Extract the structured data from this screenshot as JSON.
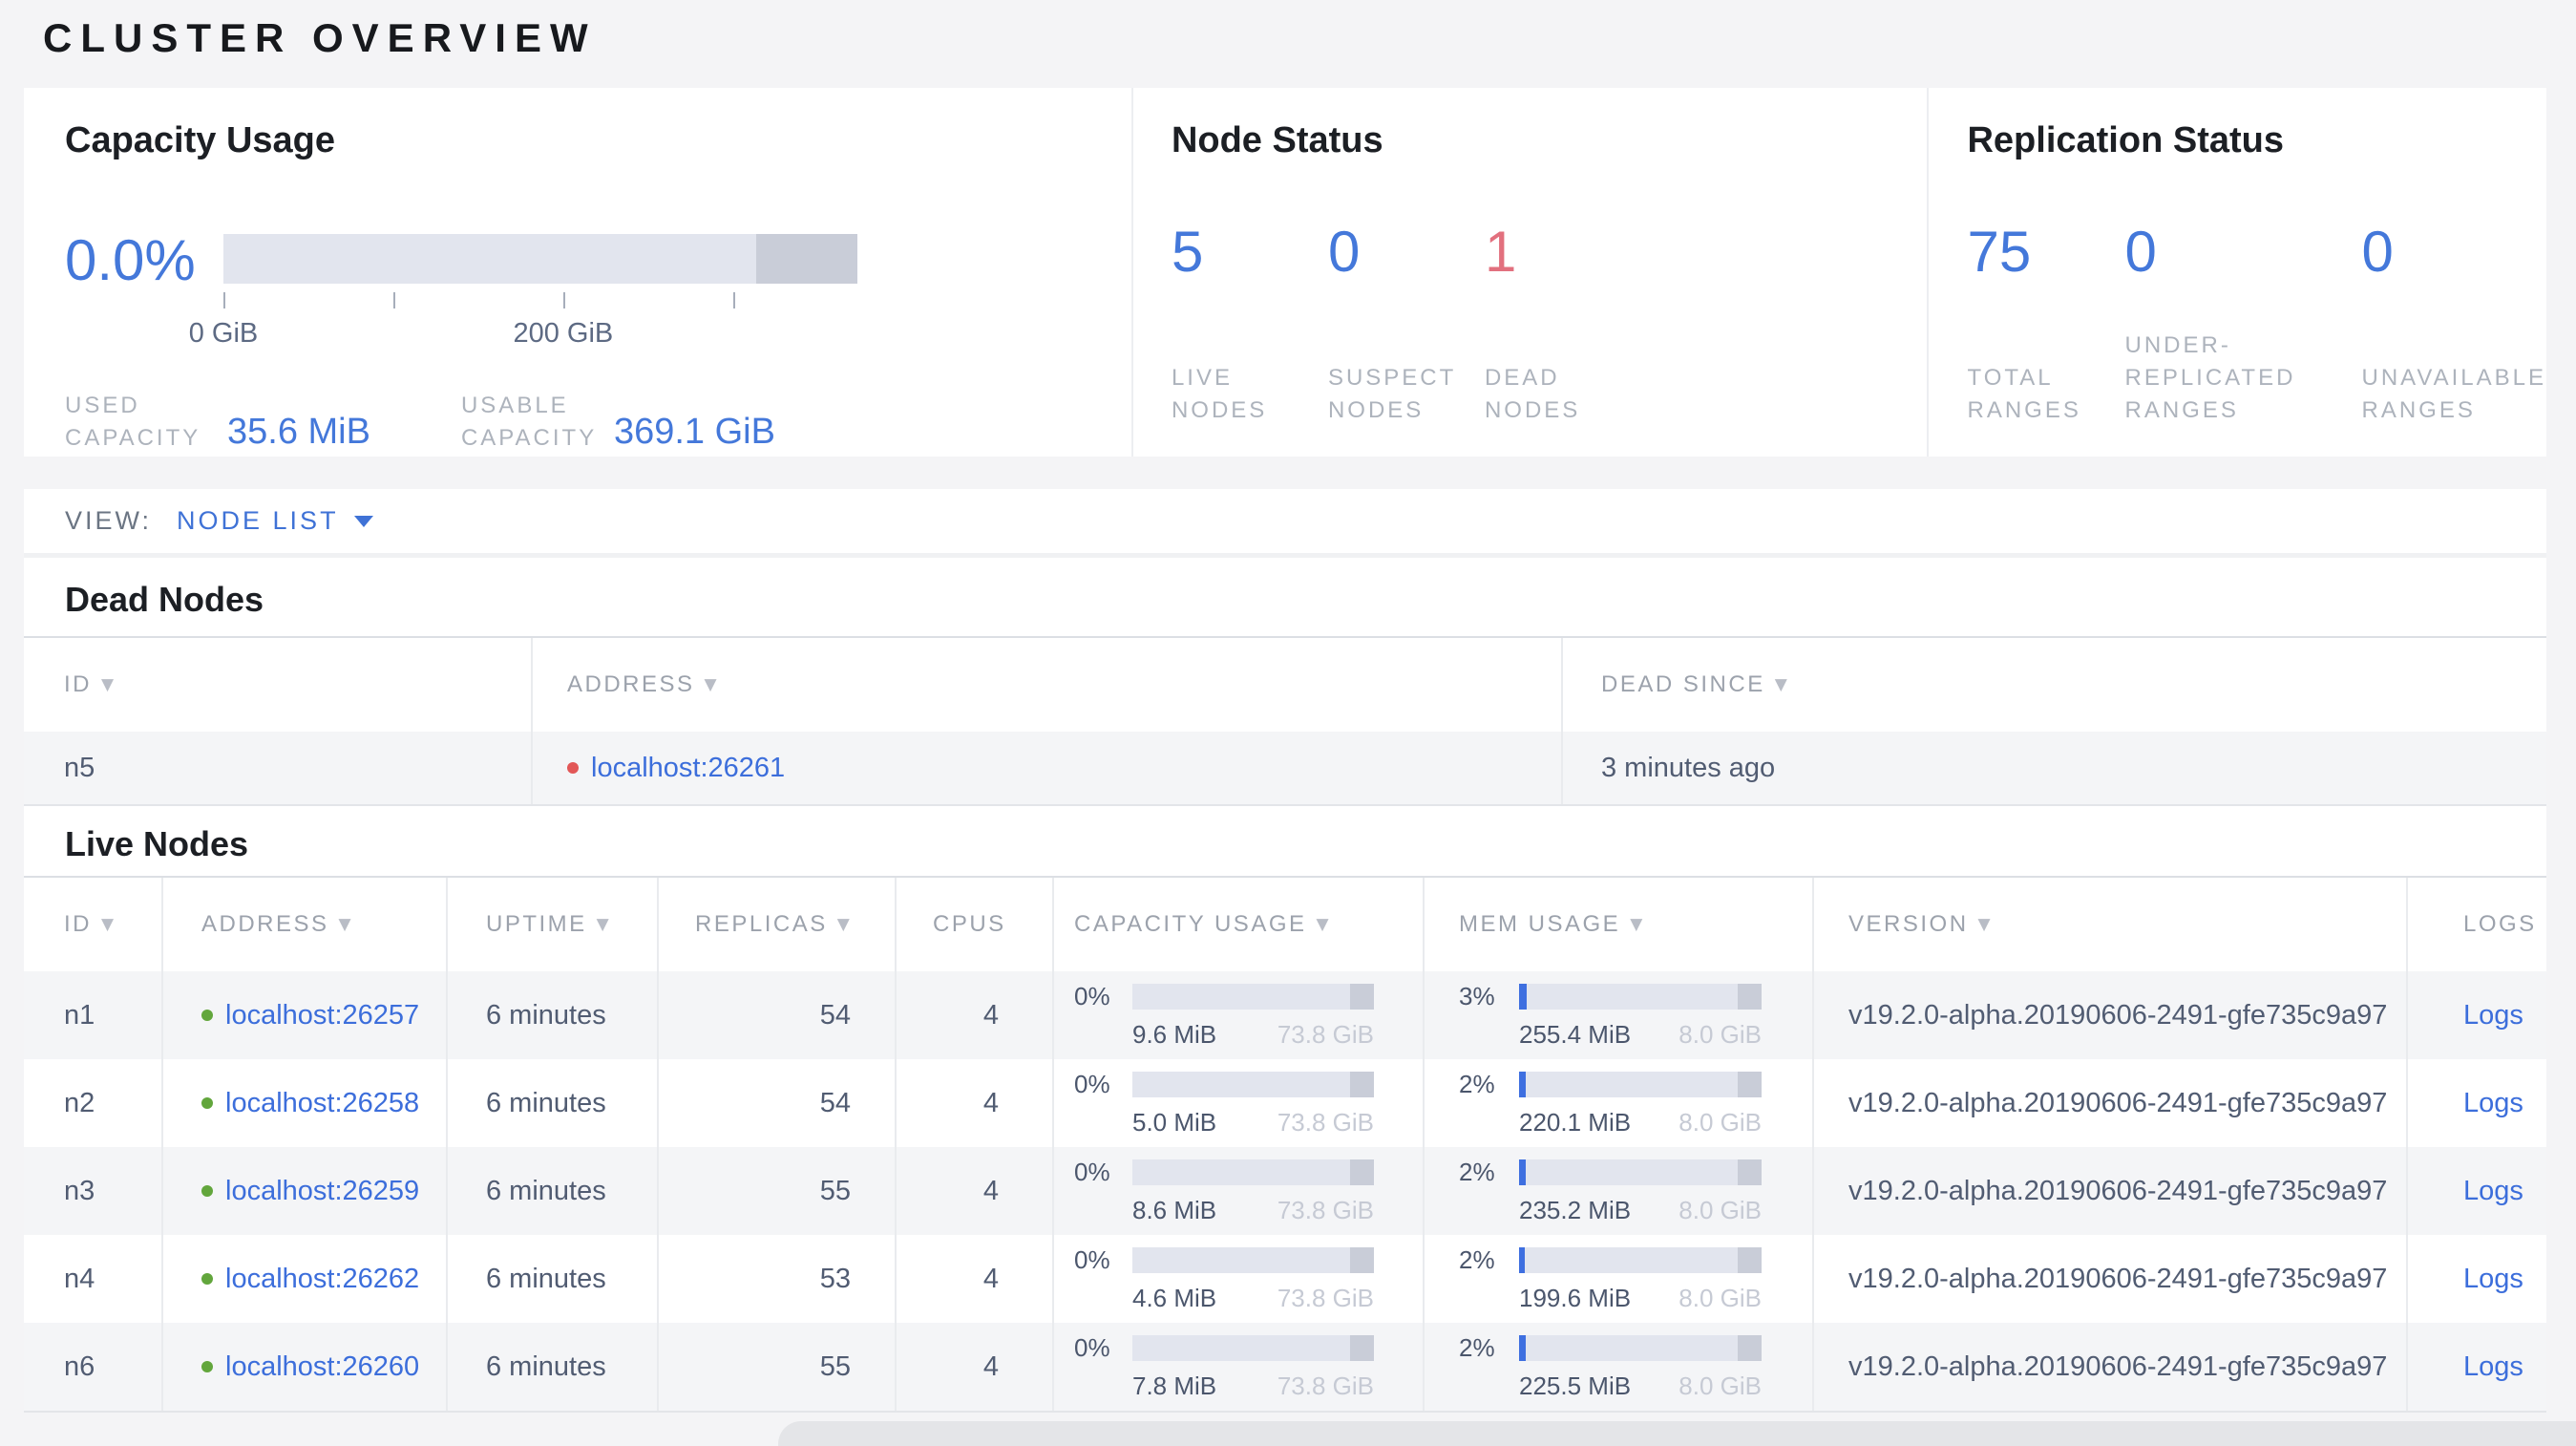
{
  "page_title": "CLUSTER OVERVIEW",
  "colors": {
    "accent_blue": "#4478da",
    "status_red": "#e2707e",
    "link_blue": "#3c6edb",
    "live_green_dot": "#62a63c",
    "dead_red_dot": "#e25757",
    "bar_track": "#e2e5ee",
    "bar_dark": "#c9cdd8",
    "bar_fill": "#3e6fe0"
  },
  "bars": {
    "row_dark_frac": 0.1
  },
  "summary": {
    "capacity": {
      "title": "Capacity Usage",
      "percent_label": "0.0%",
      "bar": {
        "fill_frac": 0.0,
        "dark_frac": 0.16,
        "ticks": [
          {
            "frac": 0.0,
            "label": "0 GiB"
          },
          {
            "frac": 0.268,
            "label": ""
          },
          {
            "frac": 0.536,
            "label": "200 GiB"
          },
          {
            "frac": 0.804,
            "label": ""
          }
        ]
      },
      "stats": [
        {
          "label_lines": [
            "USED",
            "CAPACITY"
          ],
          "value": "35.6 MiB"
        },
        {
          "label_lines": [
            "USABLE",
            "CAPACITY"
          ],
          "value": "369.1 GiB"
        }
      ]
    },
    "node_status": {
      "title": "Node Status",
      "stats": [
        {
          "value": "5",
          "color": "#4478da",
          "label_lines": [
            "LIVE",
            "NODES"
          ]
        },
        {
          "value": "0",
          "color": "#4478da",
          "label_lines": [
            "SUSPECT",
            "NODES"
          ]
        },
        {
          "value": "1",
          "color": "#e2707e",
          "label_lines": [
            "DEAD",
            "NODES"
          ]
        }
      ]
    },
    "replication": {
      "title": "Replication Status",
      "stats": [
        {
          "value": "75",
          "color": "#4478da",
          "label_lines": [
            "TOTAL",
            "RANGES"
          ]
        },
        {
          "value": "0",
          "color": "#4478da",
          "label_lines": [
            "UNDER-",
            "REPLICATED",
            "RANGES"
          ]
        },
        {
          "value": "0",
          "color": "#4478da",
          "label_lines": [
            "UNAVAILABLE",
            "RANGES"
          ]
        }
      ]
    }
  },
  "view_bar": {
    "label": "VIEW:",
    "selected": "NODE LIST"
  },
  "dead_nodes": {
    "title": "Dead Nodes",
    "columns": [
      {
        "label": "ID",
        "sortable": true
      },
      {
        "label": "ADDRESS",
        "sortable": true
      },
      {
        "label": "DEAD SINCE",
        "sortable": true
      }
    ],
    "rows": [
      {
        "id": "n5",
        "address": "localhost:26261",
        "dead_since": "3 minutes ago"
      }
    ]
  },
  "live_nodes": {
    "title": "Live Nodes",
    "columns": [
      {
        "label": "ID",
        "sortable": true
      },
      {
        "label": "ADDRESS",
        "sortable": true
      },
      {
        "label": "UPTIME",
        "sortable": true
      },
      {
        "label": "REPLICAS",
        "sortable": true
      },
      {
        "label": "CPUS",
        "sortable": false
      },
      {
        "label": "CAPACITY USAGE",
        "sortable": true
      },
      {
        "label": "MEM USAGE",
        "sortable": true
      },
      {
        "label": "VERSION",
        "sortable": true
      },
      {
        "label": "LOGS",
        "sortable": false
      }
    ],
    "rows": [
      {
        "id": "n1",
        "address": "localhost:26257",
        "uptime": "6 minutes",
        "replicas": "54",
        "cpus": "4",
        "capacity": {
          "percent_label": "0%",
          "fill_frac": 0.0,
          "used": "9.6 MiB",
          "total": "73.8 GiB"
        },
        "mem": {
          "percent_label": "3%",
          "fill_frac": 0.031,
          "used": "255.4 MiB",
          "total": "8.0 GiB"
        },
        "version": "v19.2.0-alpha.20190606-2491-gfe735c9a97",
        "logs_label": "Logs"
      },
      {
        "id": "n2",
        "address": "localhost:26258",
        "uptime": "6 minutes",
        "replicas": "54",
        "cpus": "4",
        "capacity": {
          "percent_label": "0%",
          "fill_frac": 0.0,
          "used": "5.0 MiB",
          "total": "73.8 GiB"
        },
        "mem": {
          "percent_label": "2%",
          "fill_frac": 0.027,
          "used": "220.1 MiB",
          "total": "8.0 GiB"
        },
        "version": "v19.2.0-alpha.20190606-2491-gfe735c9a97",
        "logs_label": "Logs"
      },
      {
        "id": "n3",
        "address": "localhost:26259",
        "uptime": "6 minutes",
        "replicas": "55",
        "cpus": "4",
        "capacity": {
          "percent_label": "0%",
          "fill_frac": 0.0,
          "used": "8.6 MiB",
          "total": "73.8 GiB"
        },
        "mem": {
          "percent_label": "2%",
          "fill_frac": 0.029,
          "used": "235.2 MiB",
          "total": "8.0 GiB"
        },
        "version": "v19.2.0-alpha.20190606-2491-gfe735c9a97",
        "logs_label": "Logs"
      },
      {
        "id": "n4",
        "address": "localhost:26262",
        "uptime": "6 minutes",
        "replicas": "53",
        "cpus": "4",
        "capacity": {
          "percent_label": "0%",
          "fill_frac": 0.0,
          "used": "4.6 MiB",
          "total": "73.8 GiB"
        },
        "mem": {
          "percent_label": "2%",
          "fill_frac": 0.024,
          "used": "199.6 MiB",
          "total": "8.0 GiB"
        },
        "version": "v19.2.0-alpha.20190606-2491-gfe735c9a97",
        "logs_label": "Logs"
      },
      {
        "id": "n6",
        "address": "localhost:26260",
        "uptime": "6 minutes",
        "replicas": "55",
        "cpus": "4",
        "capacity": {
          "percent_label": "0%",
          "fill_frac": 0.0,
          "used": "7.8 MiB",
          "total": "73.8 GiB"
        },
        "mem": {
          "percent_label": "2%",
          "fill_frac": 0.028,
          "used": "225.5 MiB",
          "total": "8.0 GiB"
        },
        "version": "v19.2.0-alpha.20190606-2491-gfe735c9a97",
        "logs_label": "Logs"
      }
    ]
  }
}
